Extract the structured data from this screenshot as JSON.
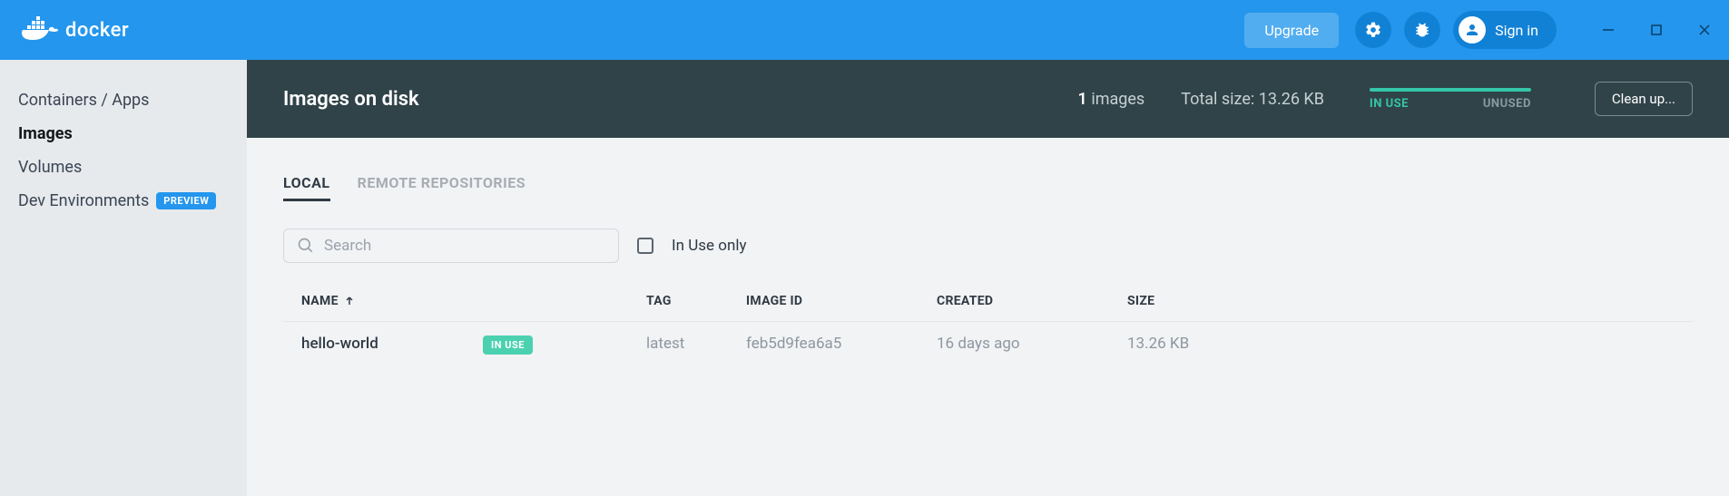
{
  "titlebar": {
    "brand": "docker",
    "upgrade_label": "Upgrade",
    "signin_label": "Sign in"
  },
  "sidebar": {
    "items": [
      {
        "label": "Containers / Apps"
      },
      {
        "label": "Images"
      },
      {
        "label": "Volumes"
      },
      {
        "label": "Dev Environments",
        "badge": "PREVIEW"
      }
    ]
  },
  "diskhead": {
    "title": "Images on disk",
    "count_num": "1",
    "count_word": "images",
    "total_label": "Total size:",
    "total_value": "13.26 KB",
    "inuse_label": "IN USE",
    "unused_label": "UNUSED",
    "cleanup_label": "Clean up..."
  },
  "tabs": {
    "local": "LOCAL",
    "remote": "REMOTE REPOSITORIES"
  },
  "filter": {
    "search_placeholder": "Search",
    "inuse_only_label": "In Use only"
  },
  "table": {
    "headers": {
      "name": "NAME",
      "tag": "TAG",
      "image_id": "IMAGE ID",
      "created": "CREATED",
      "size": "SIZE"
    },
    "rows": [
      {
        "name": "hello-world",
        "badge": "IN USE",
        "tag": "latest",
        "image_id": "feb5d9fea6a5",
        "created": "16 days ago",
        "size": "13.26 KB"
      }
    ]
  }
}
